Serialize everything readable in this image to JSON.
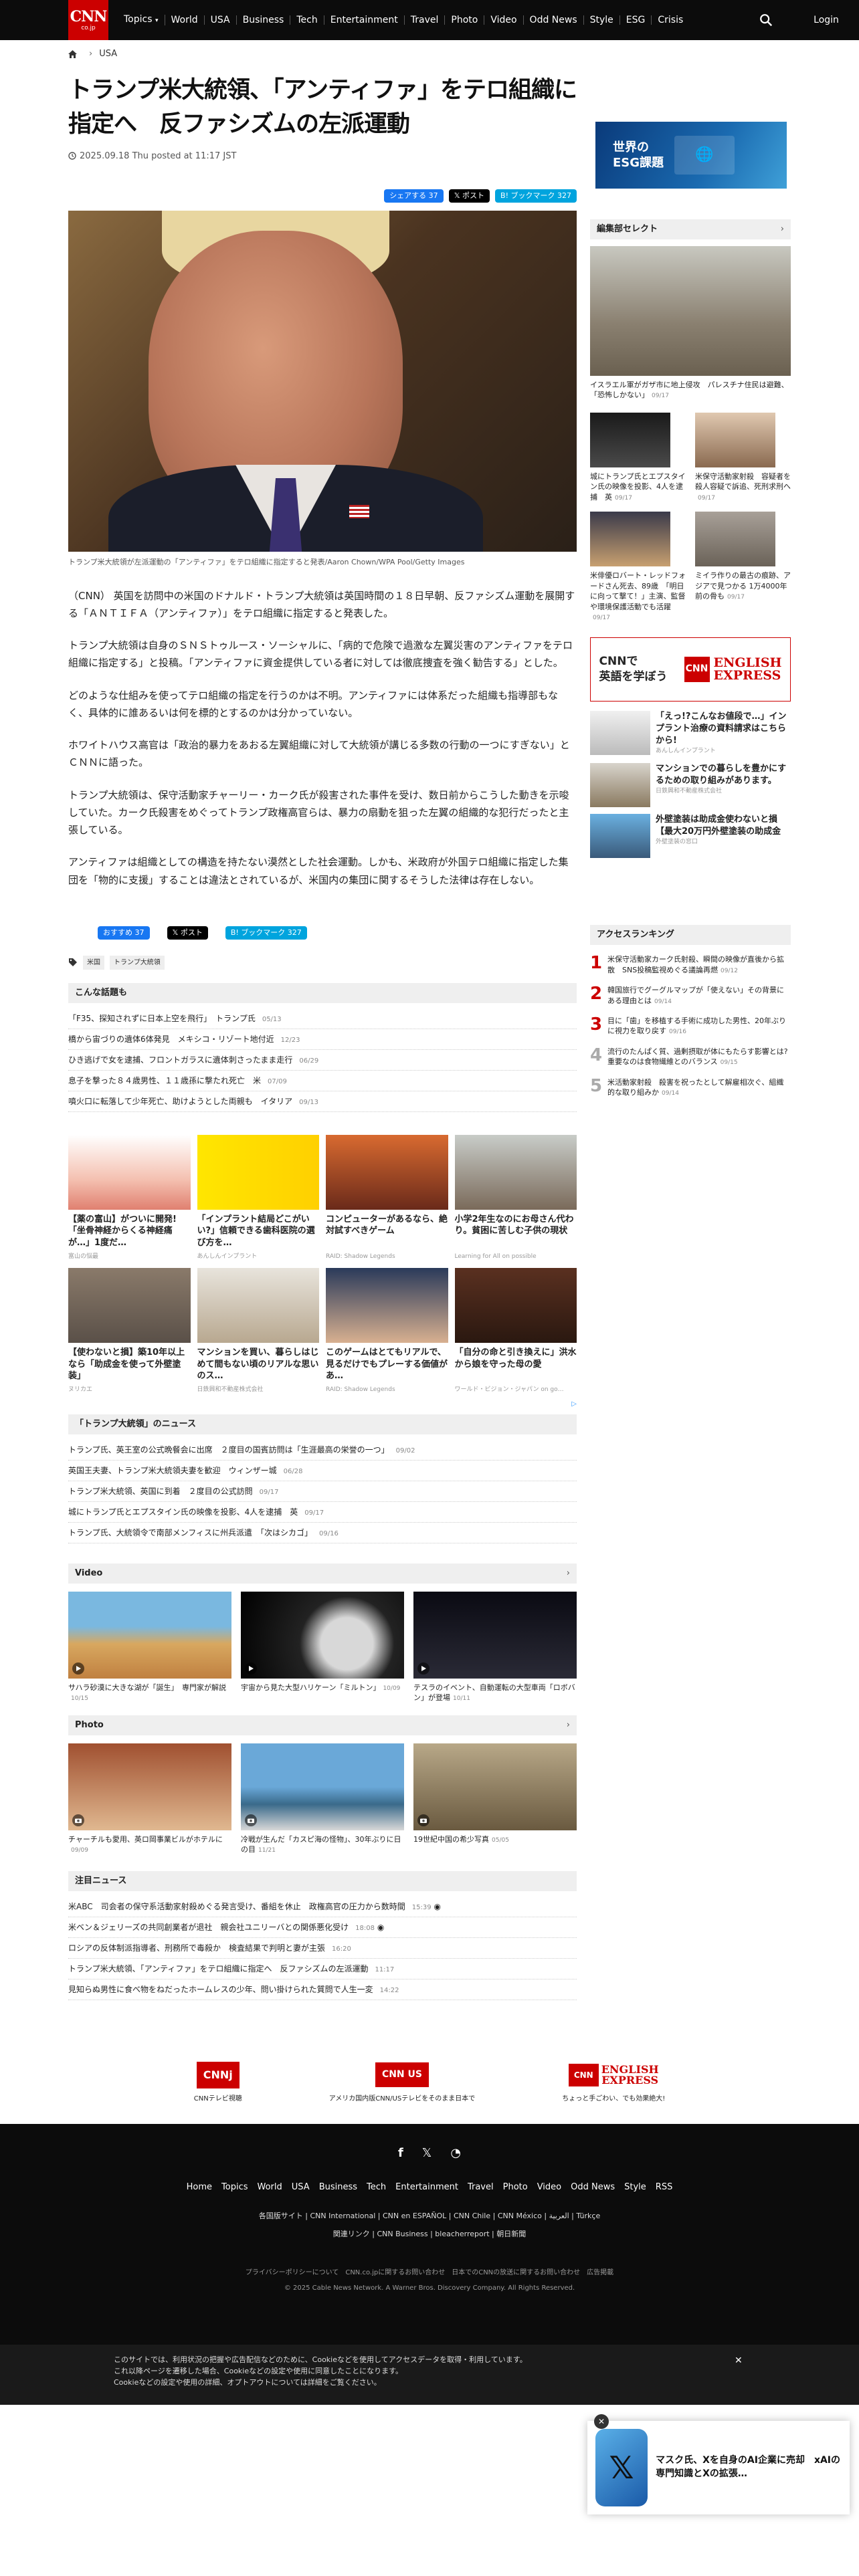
{
  "header": {
    "logo": "CNN",
    "logo_sub": "co.jp",
    "nav": [
      "Topics",
      "World",
      "USA",
      "Business",
      "Tech",
      "Entertainment",
      "Travel",
      "Photo",
      "Video",
      "Odd News",
      "Style",
      "ESG",
      "Crisis"
    ],
    "login": "Login"
  },
  "breadcrumb": {
    "section": "USA"
  },
  "article": {
    "title": "トランプ米大統領、「アンティファ」をテロ組織に指定へ　反ファシズムの左派運動",
    "date": "2025.09.18 Thu posted at 11:17 JST",
    "share": {
      "fb": "シェアする 37",
      "x": "ポスト",
      "hb": "ブックマーク 327"
    },
    "caption": "トランプ米大統領が左派運動の「アンティファ」をテロ組織に指定すると発表/Aaron Chown/WPA Pool/Getty Images",
    "paragraphs": [
      "（CNN） 英国を訪問中の米国のドナルド・トランプ大統領は英国時間の１８日早朝、反ファシズム運動を展開する「ＡＮＴＩＦＡ（アンティファ）」をテロ組織に指定すると発表した。",
      "トランプ大統領は自身のＳＮＳトゥルース・ソーシャルに、「病的で危険で過激な左翼災害のアンティファをテロ組織に指定する」と投稿。「アンティファに資金提供している者に対しては徹底捜査を強く勧告する」とした。",
      "どのような仕組みを使ってテロ組織の指定を行うのかは不明。アンティファには体系だった組織も指導部もなく、具体的に誰あるいは何を標的とするのかは分かっていない。",
      "ホワイトハウス高官は「政治的暴力をあおる左翼組織に対して大統領が講じる多数の行動の一つにすぎない」とＣＮＮに語った。",
      "トランプ大統領は、保守活動家チャーリー・カーク氏が殺害された事件を受け、数日前からこうした動きを示唆していた。カーク氏殺害をめぐってトランプ政権高官らは、暴力の扇動を狙った左翼の組織的な犯行だったと主張している。",
      "アンティファは組織としての構造を持たない漠然とした社会運動。しかも、米政府が外国テロ組織に指定した集団を「物的に支援」することは違法とされているが、米国内の集団に関するそうした法律は存在しない。"
    ],
    "share2": {
      "fb": "おすすめ 37",
      "x": "ポスト",
      "hb": "ブックマーク 327"
    },
    "tags": [
      "米国",
      "トランプ大統領"
    ]
  },
  "topics": {
    "heading": "こんな話題も",
    "items": [
      {
        "t": "「F35、探知されずに日本上空を飛行」　トランプ氏",
        "d": "05/13"
      },
      {
        "t": "橋から宙づりの遺体6体発見　メキシコ・リゾート地付近",
        "d": "12/23"
      },
      {
        "t": "ひき逃げで女を逮捕、フロントガラスに遺体刺さったまま走行",
        "d": "06/29"
      },
      {
        "t": "息子を撃った８４歳男性、１１歳孫に撃たれ死亡　米",
        "d": "07/09"
      },
      {
        "t": "噴火口に転落して少年死亡、助けようとした両親も　イタリア",
        "d": "09/13"
      }
    ]
  },
  "ads": {
    "cards": [
      {
        "t": "【薬の富山】がついに開発!「坐骨神経からくる神経痛が…」1度だ…",
        "s": "富山の悩最"
      },
      {
        "t": "「インプラント結局どこがいい?」信頼できる歯科医院の選び方を…",
        "s": "あんしんインプラント"
      },
      {
        "t": "コンピューターがあるなら、絶対試すべきゲーム",
        "s": "RAID: Shadow Legends"
      },
      {
        "t": "小学2年生なのにお母さん代わり。貧困に苦しむ子供の現状",
        "s": "Learning for All on possible"
      },
      {
        "t": "【使わないと損】築10年以上なら「助成金を使って外壁塗装」",
        "s": "ヌリカエ"
      },
      {
        "t": "マンションを買い、暮らしはじめて間もない頃のリアルな思いのス…",
        "s": "日鉄興和不動産株式会社"
      },
      {
        "t": "このゲームはとてもリアルで、見るだけでもプレーする価値があ…",
        "s": "RAID: Shadow Legends"
      },
      {
        "t": "「自分の命と引き換えに」洪水から娘を守った母の愛",
        "s": "ワールド・ビジョン・ジャパン on go…"
      }
    ]
  },
  "related": {
    "heading": "「トランプ大統領」のニュース",
    "items": [
      {
        "t": "トランプ氏、英王室の公式晩餐会に出席　２度目の国賓訪問は「生涯最高の栄誉の一つ」",
        "d": "09/02"
      },
      {
        "t": "英国王夫妻、トランプ米大統領夫妻を歓迎　ウィンザー城",
        "d": "06/28"
      },
      {
        "t": "トランプ米大統領、英国に到着　２度目の公式訪問",
        "d": "09/17"
      },
      {
        "t": "城にトランプ氏とエプスタイン氏の映像を投影、4人を逮捕　英",
        "d": "09/17"
      },
      {
        "t": "トランプ氏、大統領令で南部メンフィスに州兵派遣　「次はシカゴ」",
        "d": "09/16"
      }
    ]
  },
  "video": {
    "heading": "Video",
    "items": [
      {
        "t": "サハラ砂漠に大きな湖が「誕生」　専門家が解説",
        "d": "10/15"
      },
      {
        "t": "宇宙から見た大型ハリケーン「ミルトン」",
        "d": "10/09"
      },
      {
        "t": "テスラのイベント、自動運転の大型車両「ロボバン」が登場",
        "d": "10/11"
      }
    ]
  },
  "photo": {
    "heading": "Photo",
    "items": [
      {
        "t": "チャーチルも愛用、英ロ岡事業ビルがホテルに",
        "d": "09/09"
      },
      {
        "t": "冷戦が生んだ「カスピ海の怪物」、30年ぶりに日の目",
        "d": "11/21"
      },
      {
        "t": "19世紀中国の希少写真",
        "d": "05/05"
      }
    ]
  },
  "attention": {
    "heading": "注目ニュース",
    "items": [
      {
        "t": "米ABC　司会者の保守系活動家射殺めぐる発言受け、番組を休止　政権高官の圧力から数時間",
        "d": "15:39"
      },
      {
        "t": "米ベン＆ジェリーズの共同創業者が退社　親会社ユニリーバとの関係悪化受け",
        "d": "18:08"
      },
      {
        "t": "ロシアの反体制派指導者、刑務所で毒殺か　検査結果で判明と妻が主張",
        "d": "16:20"
      },
      {
        "t": "トランプ米大統領、「アンティファ」をテロ組織に指定へ　反ファシズムの左派運動",
        "d": "11:17"
      },
      {
        "t": "見知らぬ男性に食べ物をねだったホームレスの少年、問い掛けられた質問で人生一変",
        "d": "14:22"
      }
    ]
  },
  "footer_logos": [
    {
      "label": "CNNテレビ視聴"
    },
    {
      "label": "アメリカ国内版CNN/USテレビをそのまま日本で"
    },
    {
      "label": "ちょっと手ごわい、でも効果絶大!"
    }
  ],
  "footer": {
    "nav": [
      "Home",
      "Topics",
      "World",
      "USA",
      "Business",
      "Tech",
      "Entertainment",
      "Travel",
      "Photo",
      "Video",
      "Odd News",
      "Style",
      "RSS"
    ],
    "sub": "各国版サイト | CNN International | CNN en ESPAÑOL | CNN Chile | CNN México | العربية | Türkçe",
    "sub2": "関連リンク | CNN Business | bleacherreport | 朝日新聞",
    "legal": "プライバシーポリシーについて　CNN.co.jpに関するお問い合わせ　日本でのCNNの放送に関するお問い合わせ　広告掲載",
    "copy": "© 2025 Cable News Network. A Warner Bros. Discovery Company. All Rights Reserved."
  },
  "cookie": {
    "l1": "このサイトでは、利用状況の把握や広告配信などのために、Cookieなどを使用してアクセスデータを取得・利用しています。",
    "l2": "これ以降ページを遷移した場合、Cookieなどの設定や使用に同意したことになります。",
    "l3": "Cookieなどの設定や使用の詳細、オプトアウトについては詳細をご覧ください。"
  },
  "side": {
    "esg": "世界の\nESG課題",
    "select_heading": "編集部セレクト",
    "big": {
      "t": "イスラエル軍がガザ市に地上侵攻　パレスチナ住民は避難、「恐怖しかない」",
      "d": "09/17"
    },
    "pairs": [
      {
        "t": "城にトランプ氏とエプスタイン氏の映像を投影、4人を逮捕　英",
        "d": "09/17"
      },
      {
        "t": "米保守活動家射殺　容疑者を殺人容疑で訴追、死刑求刑へ",
        "d": "09/17"
      },
      {
        "t": "米俳優ロバート・レッドフォードさん死去、89歳　「明日に向って撃て！」主演、監督や環境保護活動でも活躍",
        "d": "09/17"
      },
      {
        "t": "ミイラ作りの最古の痕跡、アジアで見つかる 1万4000年前の骨も",
        "d": "09/17"
      }
    ],
    "cnn_ad": {
      "l": "CNNで\n英語を学ぼう",
      "lg": "CNN",
      "ee": "ENGLISH\nEXPRESS"
    },
    "ads": [
      {
        "t": "「えっ!?こんなお値段で…」インプラント治療の資料請求はこちらから!",
        "s": "あんしんインプラント"
      },
      {
        "t": "マンションでの暮らしを豊かにするための取り組みがあります。",
        "s": "日鉄興和不動産株式会社"
      },
      {
        "t": "外壁塗装は助成金使わないと損【最大20万円外壁塗装の助成金",
        "s": "外壁塗装の窓口"
      }
    ],
    "ranking_heading": "アクセスランキング",
    "ranking": [
      {
        "n": "1",
        "t": "米保守活動家カーク氏射殺、瞬間の映像が直後から拡散　SNS投稿監視めぐる議論再燃",
        "d": "09/12"
      },
      {
        "n": "2",
        "t": "韓国旅行でグーグルマップが「使えない」その背景にある理由とは",
        "d": "09/14"
      },
      {
        "n": "3",
        "t": "目に「歯」を移植する手術に成功した男性、20年ぶりに視力を取り戻す",
        "d": "09/16"
      },
      {
        "n": "4",
        "t": "流行のたんぱく質、過剰摂取が体にもたらす影響とは?　重要なのは食物繊維とのバランス",
        "d": "09/15"
      },
      {
        "n": "5",
        "t": "米活動家射殺　殺害を祝ったとして解雇相次ぐ、組織的な取り組みか",
        "d": "09/14"
      }
    ]
  },
  "promo": {
    "t": "マスク氏、Xを自身のAI企業に売却　xAIの専門知識とXの拡張…"
  },
  "colors": {
    "brand": "#cc0000",
    "topbar": "#0c0c0c"
  }
}
